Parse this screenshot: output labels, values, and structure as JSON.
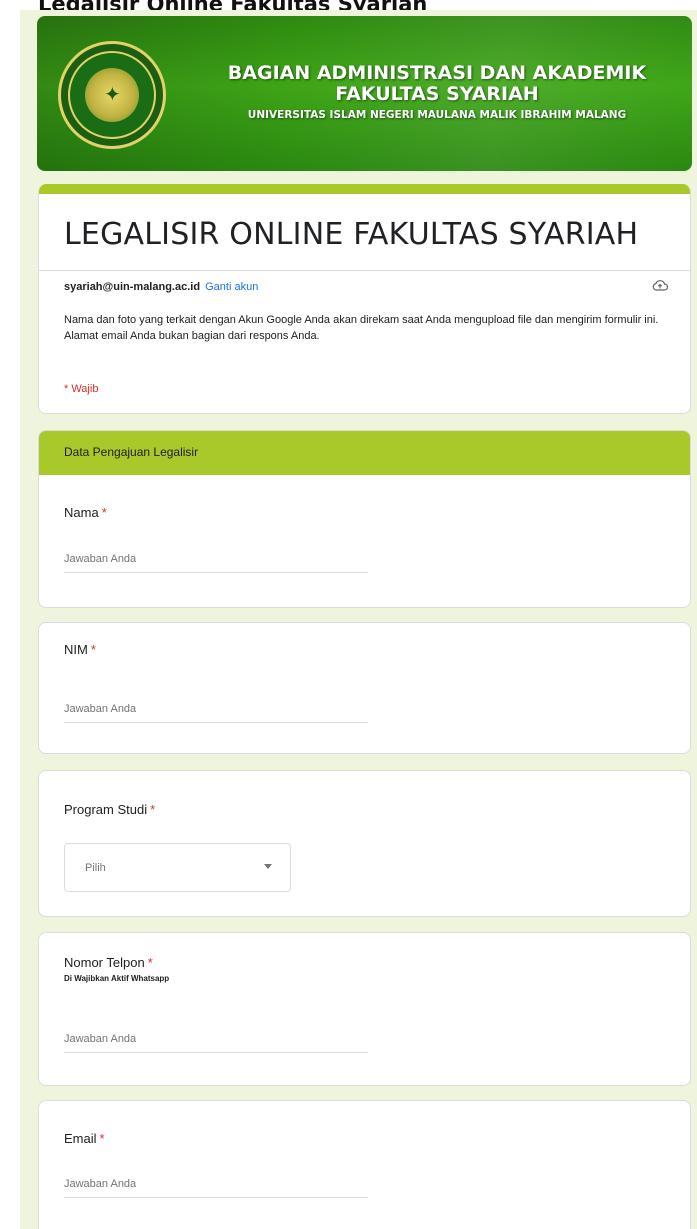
{
  "header": {
    "cut_title": "Legalisir Online Fakultas Syariah",
    "banner_line1": "BAGIAN ADMINISTRASI DAN AKADEMIK",
    "banner_line2": "FAKULTAS SYARIAH",
    "banner_line3": "UNIVERSITAS ISLAM NEGERI MAULANA MALIK IBRAHIM MALANG",
    "logo_icon": "university-seal"
  },
  "form": {
    "title": "LEGALISIR ONLINE FAKULTAS SYARIAH",
    "account_email": "syariah@uin-malang.ac.id",
    "switch_account": "Ganti akun",
    "notice": "Nama dan foto yang terkait dengan Akun Google Anda akan direkam saat Anda mengupload file dan mengirim formulir ini. Alamat email Anda bukan bagian dari respons Anda.",
    "required_note": "* Wajib",
    "section_title": "Data Pengajuan Legalisir",
    "required_star": "*"
  },
  "questions": {
    "nama": {
      "label": "Nama",
      "placeholder": "Jawaban Anda"
    },
    "nim": {
      "label": "NIM",
      "placeholder": "Jawaban Anda"
    },
    "prodi": {
      "label": "Program Studi",
      "selected": "Pilih"
    },
    "telpon": {
      "label": "Nomor Telpon",
      "hint": "Di Wajibkan Aktif Whatsapp",
      "placeholder": "Jawaban Anda"
    },
    "email": {
      "label": "Email",
      "placeholder": "Jawaban Anda"
    }
  },
  "colors": {
    "accent": "#a8c929",
    "banner_green": "#3ea617",
    "page_background": "#eef5dc",
    "required_red": "#d93025",
    "link_blue": "#1a73e8"
  }
}
